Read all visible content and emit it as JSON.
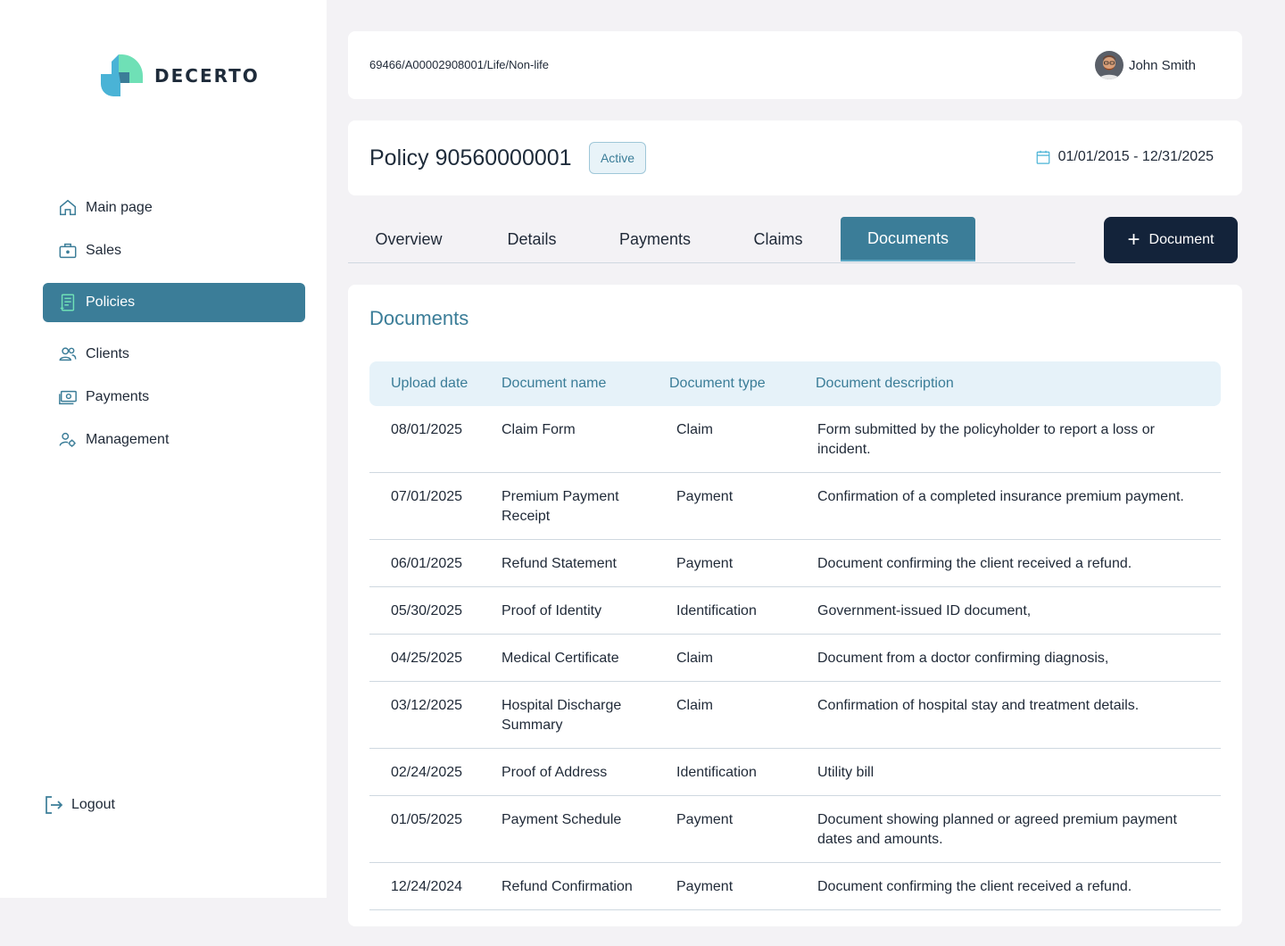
{
  "brand": {
    "name": "DECERTO",
    "colors": {
      "primary": "#3b7d98",
      "dark": "#13233a",
      "mint": "#6fe0b6",
      "sky": "#4ab3d6"
    }
  },
  "sidebar": {
    "items": [
      {
        "label": "Main page",
        "icon": "home-icon"
      },
      {
        "label": "Sales",
        "icon": "briefcase-icon"
      },
      {
        "label": "Policies",
        "icon": "document-icon",
        "active": true
      },
      {
        "label": "Clients",
        "icon": "users-icon"
      },
      {
        "label": "Payments",
        "icon": "cash-icon"
      },
      {
        "label": "Management",
        "icon": "user-settings-icon"
      }
    ],
    "logout": "Logout"
  },
  "header": {
    "breadcrumb": "69466/A00002908001/Life/Non-life",
    "user": "John Smith"
  },
  "policy": {
    "title": "Policy 90560000001",
    "status": "Active",
    "period": "01/01/2015 - 12/31/2025"
  },
  "tabs": [
    "Overview",
    "Details",
    "Payments",
    "Claims",
    "Documents"
  ],
  "active_tab": "Documents",
  "add_button": "Document",
  "documents": {
    "title": "Documents",
    "columns": [
      "Upload date",
      "Document name",
      "Document type",
      "Document description"
    ],
    "rows": [
      [
        "08/01/2025",
        "Claim Form",
        "Claim",
        "Form submitted by the policyholder to report a loss or incident."
      ],
      [
        "07/01/2025",
        "Premium Payment Receipt",
        "Payment",
        "Confirmation of a completed insurance premium payment."
      ],
      [
        "06/01/2025",
        "Refund Statement",
        "Payment",
        "Document confirming the client received a refund."
      ],
      [
        "05/30/2025",
        "Proof of Identity",
        "Identification",
        "Government-issued ID document,"
      ],
      [
        "04/25/2025",
        "Medical Certificate",
        "Claim",
        "Document from a doctor confirming diagnosis,"
      ],
      [
        "03/12/2025",
        "Hospital Discharge Summary",
        "Claim",
        "Confirmation of hospital stay and treatment details."
      ],
      [
        "02/24/2025",
        "Proof of Address",
        "Identification",
        "Utility bill"
      ],
      [
        "01/05/2025",
        "Payment Schedule",
        "Payment",
        "Document showing planned or agreed premium payment dates and amounts."
      ],
      [
        "12/24/2024",
        "Refund Confirmation",
        "Payment",
        "Document confirming the client received a refund."
      ]
    ]
  }
}
